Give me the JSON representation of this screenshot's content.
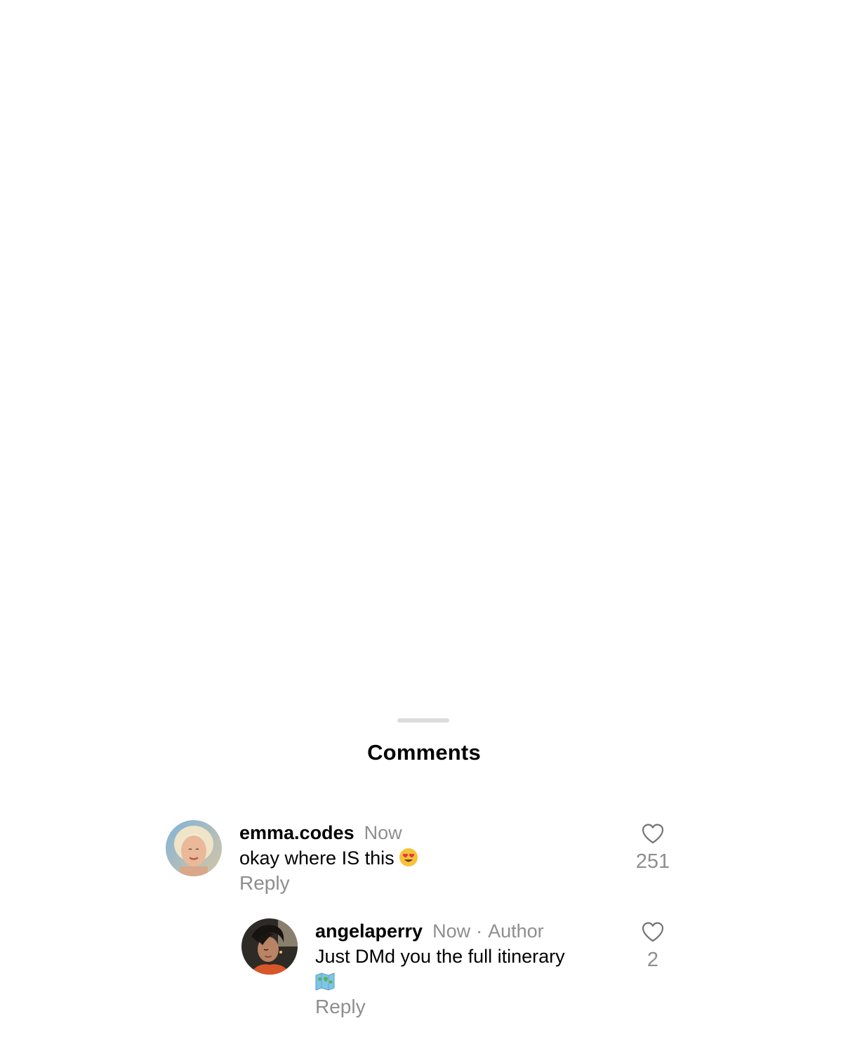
{
  "sheet": {
    "title": "Comments"
  },
  "comments": [
    {
      "username": "emma.codes",
      "time": "Now",
      "text": "okay where IS this",
      "emoji": "heart-eyes-face",
      "reply_label": "Reply",
      "likes": "251"
    }
  ],
  "replies": [
    {
      "username": "angelaperry",
      "time": "Now",
      "separator": "·",
      "badge": "Author",
      "text": "Just DMd you the full itinerary",
      "emoji": "world-map",
      "reply_label": "Reply",
      "likes": "2"
    }
  ],
  "icons": {
    "like": "heart-outline-icon"
  },
  "colors": {
    "text_primary": "#000000",
    "text_secondary": "#8e8e8e",
    "grabber": "#dbdbdb",
    "background": "#ffffff"
  }
}
